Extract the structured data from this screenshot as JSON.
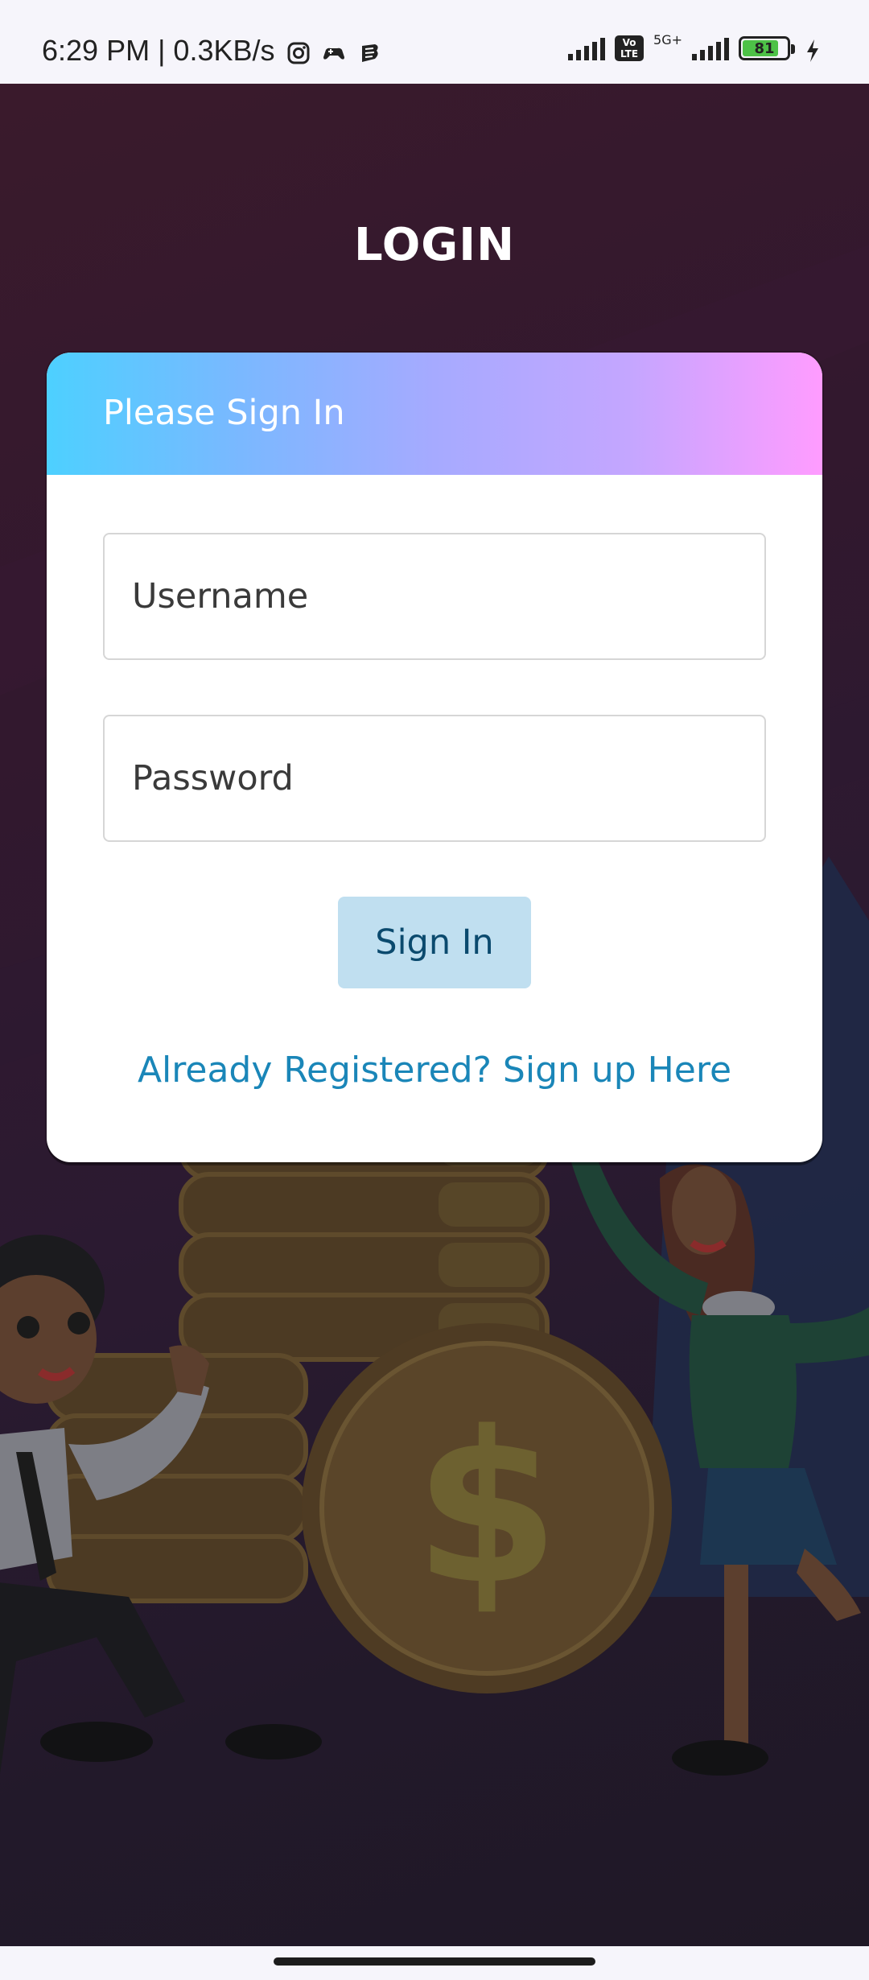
{
  "status_bar": {
    "time_speed": "6:29 PM | 0.3KB/s",
    "volte": "Vo LTE",
    "network": "5G+",
    "battery_level": "81",
    "battery_fraction": 0.81,
    "icons": [
      "instagram-icon",
      "game-controller-icon",
      "app-icon",
      "signal-icon",
      "volte-icon",
      "signal-icon",
      "battery-icon",
      "charging-icon"
    ]
  },
  "page": {
    "title": "LOGIN"
  },
  "card": {
    "header": "Please Sign In",
    "username_placeholder": "Username",
    "password_placeholder": "Password",
    "signin_label": "Sign In",
    "signup_link": "Already Registered? Sign up Here"
  },
  "colors": {
    "header_gradient_start": "#4dd0ff",
    "header_gradient_end": "#ff9cff",
    "button_bg": "#c0dff0",
    "button_text": "#0b4a6e",
    "link": "#1a86b8",
    "background": "#2a1a2e"
  }
}
